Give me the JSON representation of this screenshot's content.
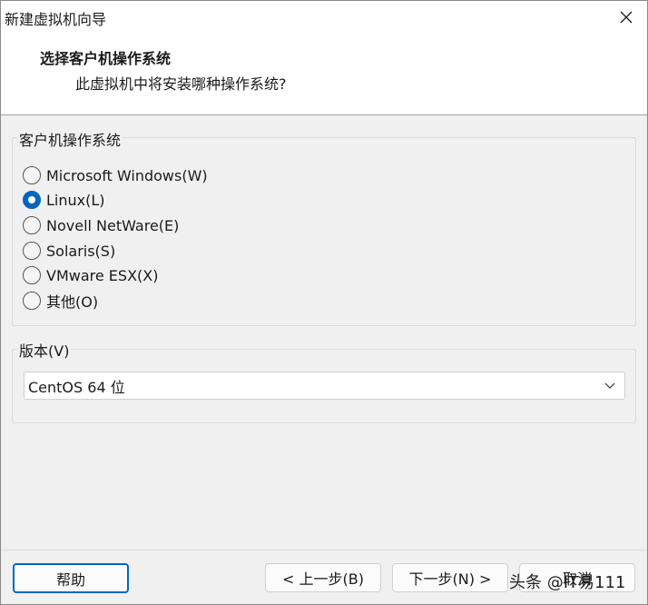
{
  "window": {
    "title": "新建虚拟机向导"
  },
  "header": {
    "title": "选择客户机操作系统",
    "subtitle": "此虚拟机中将安装哪种操作系统?"
  },
  "os_group": {
    "label": "客户机操作系统",
    "options": [
      {
        "label": "Microsoft Windows(W)",
        "checked": false
      },
      {
        "label": "Linux(L)",
        "checked": true
      },
      {
        "label": "Novell NetWare(E)",
        "checked": false
      },
      {
        "label": "Solaris(S)",
        "checked": false
      },
      {
        "label": "VMware ESX(X)",
        "checked": false
      },
      {
        "label": "其他(O)",
        "checked": false
      }
    ]
  },
  "version_group": {
    "label": "版本(V)",
    "selected": "CentOS 64 位"
  },
  "footer": {
    "help": "帮助",
    "back": "< 上一步(B)",
    "next": "下一步(N) >",
    "cancel": "取消"
  },
  "watermark": {
    "text": "头条 @IT易111"
  },
  "colors": {
    "accent": "#0067c0",
    "background": "#f0f0f0"
  }
}
